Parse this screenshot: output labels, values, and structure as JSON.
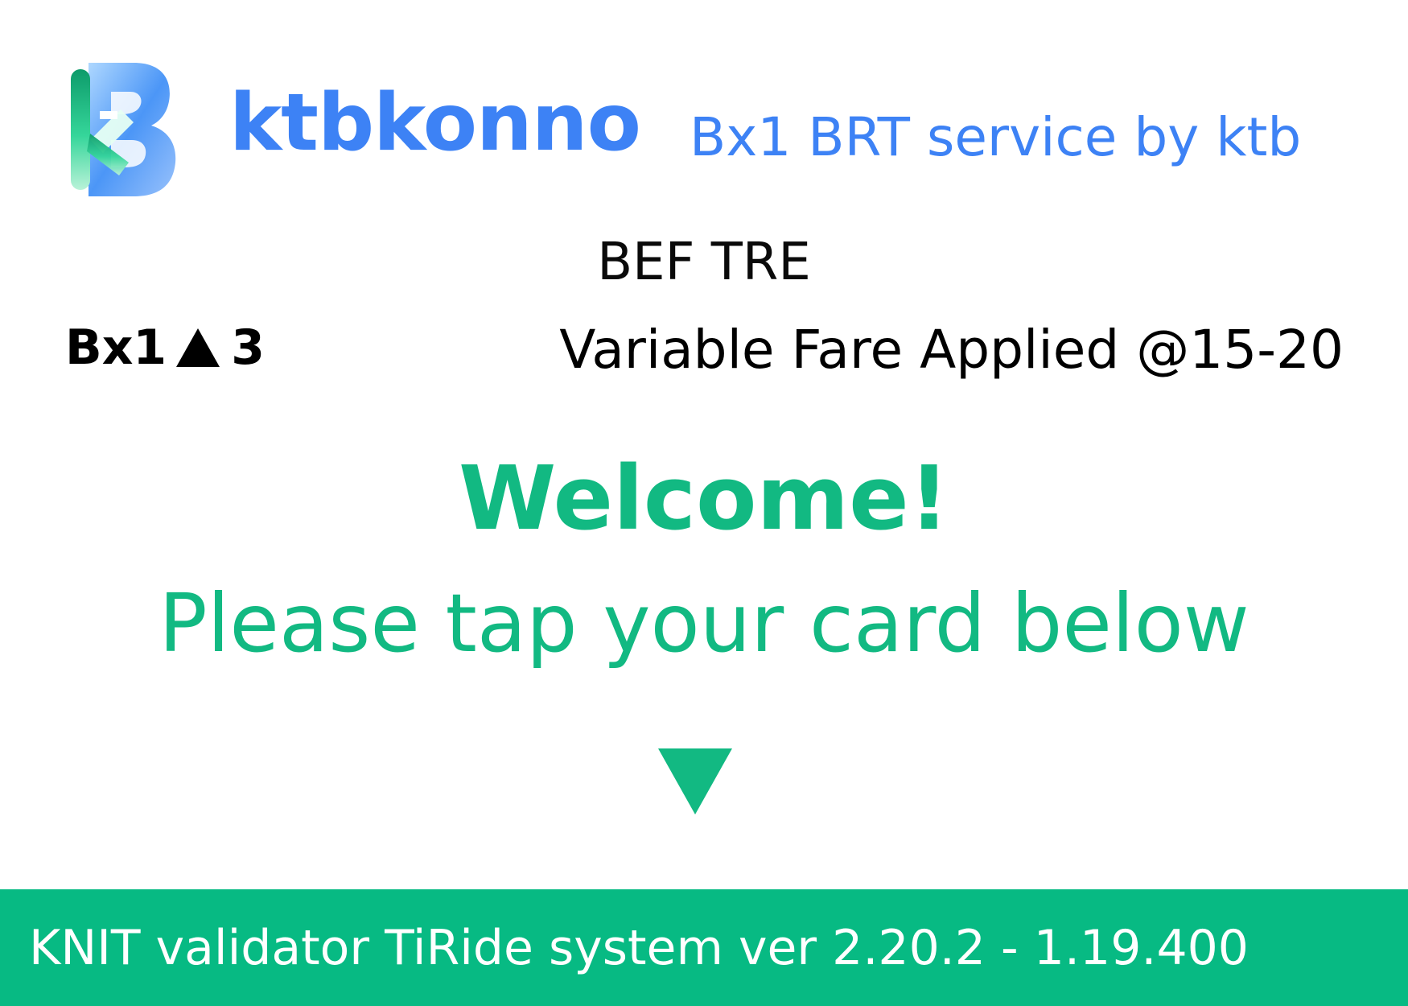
{
  "colors": {
    "brand_blue": "#3d82f5",
    "accent_green": "#12b982",
    "footer_green": "#07ba83",
    "text_dark": "#000000"
  },
  "header": {
    "logo_icon": "ktb-b-logo",
    "brand_name": "ktbkonno",
    "brand_subtitle": "Bx1 BRT service by ktb"
  },
  "trip": {
    "stop_name": "BEF TRE",
    "route_code": "Bx1",
    "direction_icon": "triangle-up-icon",
    "route_number": "3",
    "fare_notice": "Variable Fare Applied @15-20"
  },
  "main": {
    "welcome": "Welcome!",
    "instruction": "Please tap your card below",
    "pointer_icon": "triangle-down-icon"
  },
  "footer": {
    "system_info": "KNIT validator TiRide system ver 2.20.2 - 1.19.400"
  }
}
